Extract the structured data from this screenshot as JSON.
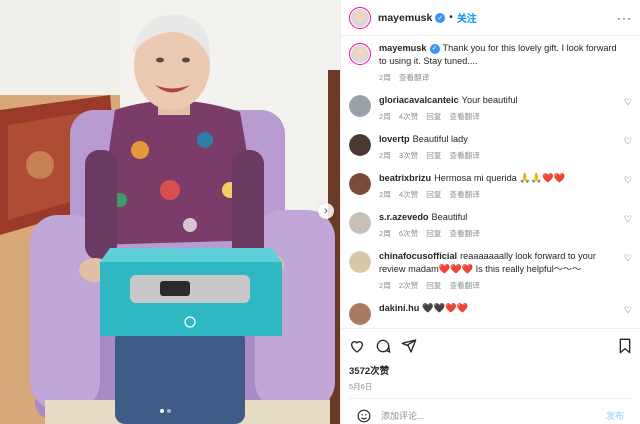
{
  "post": {
    "username": "mayemusk",
    "separator": "•",
    "follow_label": "关注",
    "more_label": "···"
  },
  "caption": {
    "username": "mayemusk",
    "text": "Thank you for this lovely gift. I look forward to using it. Stay tuned....",
    "time": "2周",
    "translate": "查看翻译"
  },
  "comments": [
    {
      "username": "gloriacavalcanteic",
      "text": "Your beautiful",
      "time": "2周",
      "likes": "4次赞",
      "reply": "回复",
      "translate": "查看翻译"
    },
    {
      "username": "lovertp",
      "text": "Beautiful lady",
      "time": "2周",
      "likes": "3次赞",
      "reply": "回复",
      "translate": "查看翻译"
    },
    {
      "username": "beatrixbrizu",
      "text": "Hermosa mi querida 🙏🙏❤️❤️",
      "time": "2周",
      "likes": "4次赞",
      "reply": "回复",
      "translate": "查看翻译"
    },
    {
      "username": "s.r.azevedo",
      "text": "Beautiful",
      "time": "2周",
      "likes": "6次赞",
      "reply": "回复",
      "translate": "查看翻译"
    },
    {
      "username": "chinafocusofficial",
      "text": "reaaaaaaally look forward to your review madam❤️❤️❤️ Is this really helpful～～～",
      "time": "2周",
      "likes": "2次赞",
      "reply": "回复",
      "translate": "查看翻译"
    },
    {
      "username": "dakini.hu",
      "text": "🖤🖤❤️❤️"
    }
  ],
  "stats": {
    "likes": "3572次赞",
    "date": "5月6日"
  },
  "composer": {
    "placeholder": "添加评论...",
    "post_label": "发布"
  },
  "colors": {
    "accent": "#0095f6",
    "verified": "#3897f0",
    "chair": "#b89bd0",
    "box": "#2fb8c4"
  },
  "icons": [
    "heart-icon",
    "comment-icon",
    "share-icon",
    "bookmark-icon",
    "emoji-icon",
    "verified-icon",
    "chevron-right-icon"
  ]
}
